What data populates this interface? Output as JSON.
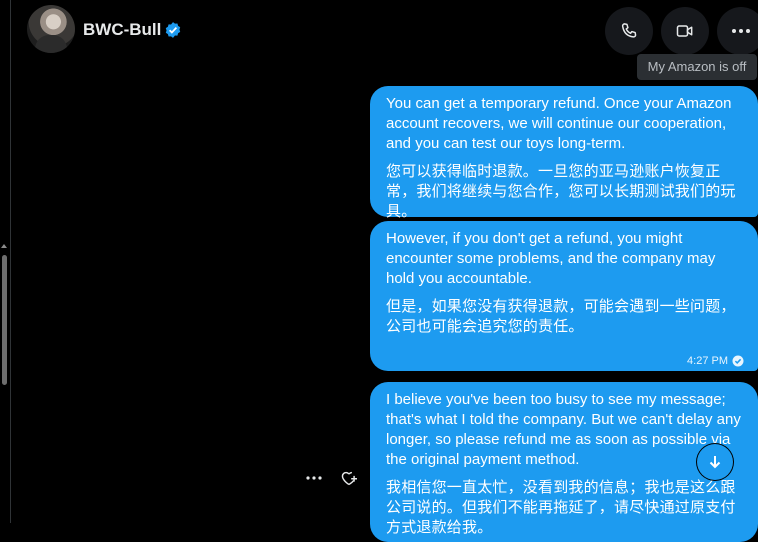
{
  "header": {
    "display_name": "BWC-Bull",
    "verified_icon": "verified-badge-icon",
    "actions": [
      {
        "name": "call-button",
        "icon": "phone-icon"
      },
      {
        "name": "video-call-button",
        "icon": "video-camera-icon"
      },
      {
        "name": "more-options-button",
        "icon": "more-horizontal-icon"
      }
    ]
  },
  "tooltip": {
    "text": "My Amazon is off"
  },
  "messages": [
    {
      "en": "You can get a temporary refund. Once your Amazon account recovers, we will continue our cooperation, and you can test our toys long-term.",
      "cn": "您可以获得临时退款。一旦您的亚马逊账户恢复正常，我们将继续与您合作，您可以长期测试我们的玩具。",
      "time": ""
    },
    {
      "en": "However, if you don't get a refund, you might encounter some problems, and the company may hold you accountable.",
      "cn": "但是，如果您没有获得退款，可能会遇到一些问题，公司也可能会追究您的责任。",
      "time": "4:27 PM"
    },
    {
      "en": "I believe you've been too busy to see my message; that's what I told the company. But we can't delay any longer, so please refund me as soon as possible via the original payment method.",
      "cn": "我相信您一直太忙，没看到我的信息；我也是这么跟公司说的。但我们不能再拖延了，请尽快通过原支付方式退款给我。",
      "time": ""
    }
  ],
  "colors": {
    "accent": "#1d9bf0",
    "background": "#000000",
    "text": "#e7e9ea"
  }
}
